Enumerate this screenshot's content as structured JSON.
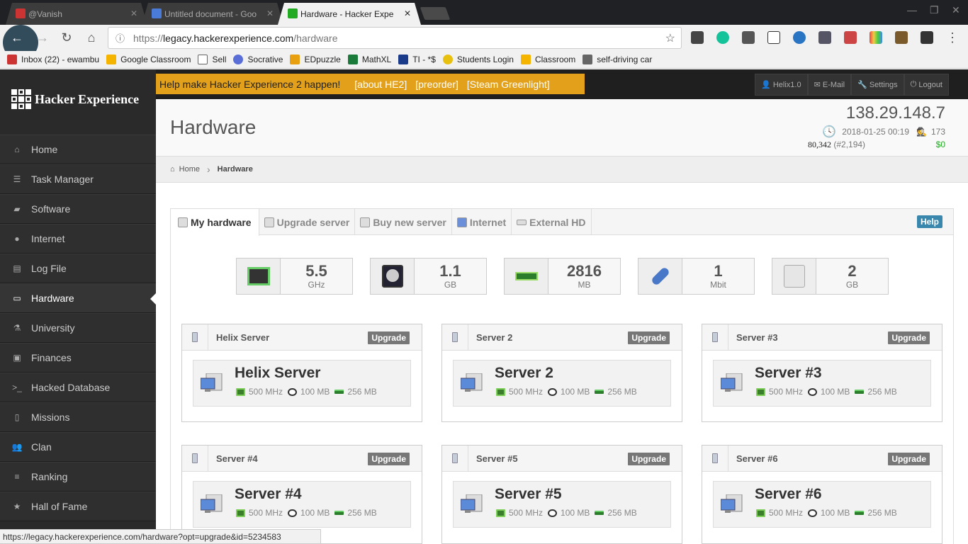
{
  "browser": {
    "tabs": [
      {
        "title": "@Vanish",
        "color": "#c33"
      },
      {
        "title": "Untitled document - Goo",
        "color": "#4a7bd8"
      },
      {
        "title": "Hardware - Hacker Expe",
        "color": "#3c3"
      }
    ],
    "url_prefix": "https://",
    "url_domain": "legacy.hackerexperience.com",
    "url_path": "/hardware",
    "bookmarks": [
      "Inbox (22) - ewambu",
      "Google Classroom",
      "Sell",
      "Socrative",
      "EDpuzzle",
      "MathXL",
      "TI - *$",
      "Students Login",
      "Classroom",
      "self-driving car"
    ],
    "status_url": "https://legacy.hackerexperience.com/hardware?opt=upgrade&id=5234583"
  },
  "brand": {
    "name": "Hacker Experience"
  },
  "banner": {
    "text": "Help make Hacker Experience 2 happen!",
    "links": [
      "[about HE2]",
      "[preorder]",
      "[Steam Greenlight]"
    ]
  },
  "userbar": {
    "user": "Helix1.0",
    "email": "E-Mail",
    "settings": "Settings",
    "logout": "Logout"
  },
  "sidebar": {
    "items": [
      {
        "label": "Home",
        "icon": "home-icon"
      },
      {
        "label": "Task Manager",
        "icon": "tasks-icon"
      },
      {
        "label": "Software",
        "icon": "folder-icon"
      },
      {
        "label": "Internet",
        "icon": "globe-icon"
      },
      {
        "label": "Log File",
        "icon": "book-icon"
      },
      {
        "label": "Hardware",
        "icon": "monitor-icon"
      },
      {
        "label": "University",
        "icon": "flask-icon"
      },
      {
        "label": "Finances",
        "icon": "briefcase-icon"
      },
      {
        "label": "Hacked Database",
        "icon": "terminal-icon"
      },
      {
        "label": "Missions",
        "icon": "document-icon"
      },
      {
        "label": "Clan",
        "icon": "group-icon"
      },
      {
        "label": "Ranking",
        "icon": "list-icon"
      },
      {
        "label": "Hall of Fame",
        "icon": "star-icon"
      }
    ]
  },
  "header": {
    "title": "Hardware",
    "ip": "138.29.148.7",
    "datetime": "2018-01-25 00:19",
    "online": "173",
    "reputation": "80,342",
    "rank": "(#2,194)",
    "money": "$0"
  },
  "breadcrumb": {
    "home": "Home",
    "current": "Hardware"
  },
  "tabs": [
    "My hardware",
    "Upgrade server",
    "Buy new server",
    "Internet",
    "External HD"
  ],
  "help_label": "Help",
  "stats": [
    {
      "value": "5.5",
      "unit": "GHz",
      "icon": "cpu-icon"
    },
    {
      "value": "1.1",
      "unit": "GB",
      "icon": "hdd-icon"
    },
    {
      "value": "2816",
      "unit": "MB",
      "icon": "ram-icon"
    },
    {
      "value": "1",
      "unit": "Mbit",
      "icon": "network-icon"
    },
    {
      "value": "2",
      "unit": "GB",
      "icon": "external-hd-icon"
    }
  ],
  "upgrade_label": "Upgrade",
  "servers": [
    {
      "header": "Helix Server",
      "name": "Helix Server",
      "cpu": "500 MHz",
      "hdd": "100 MB",
      "ram": "256 MB"
    },
    {
      "header": "Server 2",
      "name": "Server 2",
      "cpu": "500 MHz",
      "hdd": "100 MB",
      "ram": "256 MB"
    },
    {
      "header": "Server #3",
      "name": "Server #3",
      "cpu": "500 MHz",
      "hdd": "100 MB",
      "ram": "256 MB"
    },
    {
      "header": "Server #4",
      "name": "Server #4",
      "cpu": "500 MHz",
      "hdd": "100 MB",
      "ram": "256 MB"
    },
    {
      "header": "Server #5",
      "name": "Server #5",
      "cpu": "500 MHz",
      "hdd": "100 MB",
      "ram": "256 MB"
    },
    {
      "header": "Server #6",
      "name": "Server #6",
      "cpu": "500 MHz",
      "hdd": "100 MB",
      "ram": "256 MB"
    }
  ]
}
